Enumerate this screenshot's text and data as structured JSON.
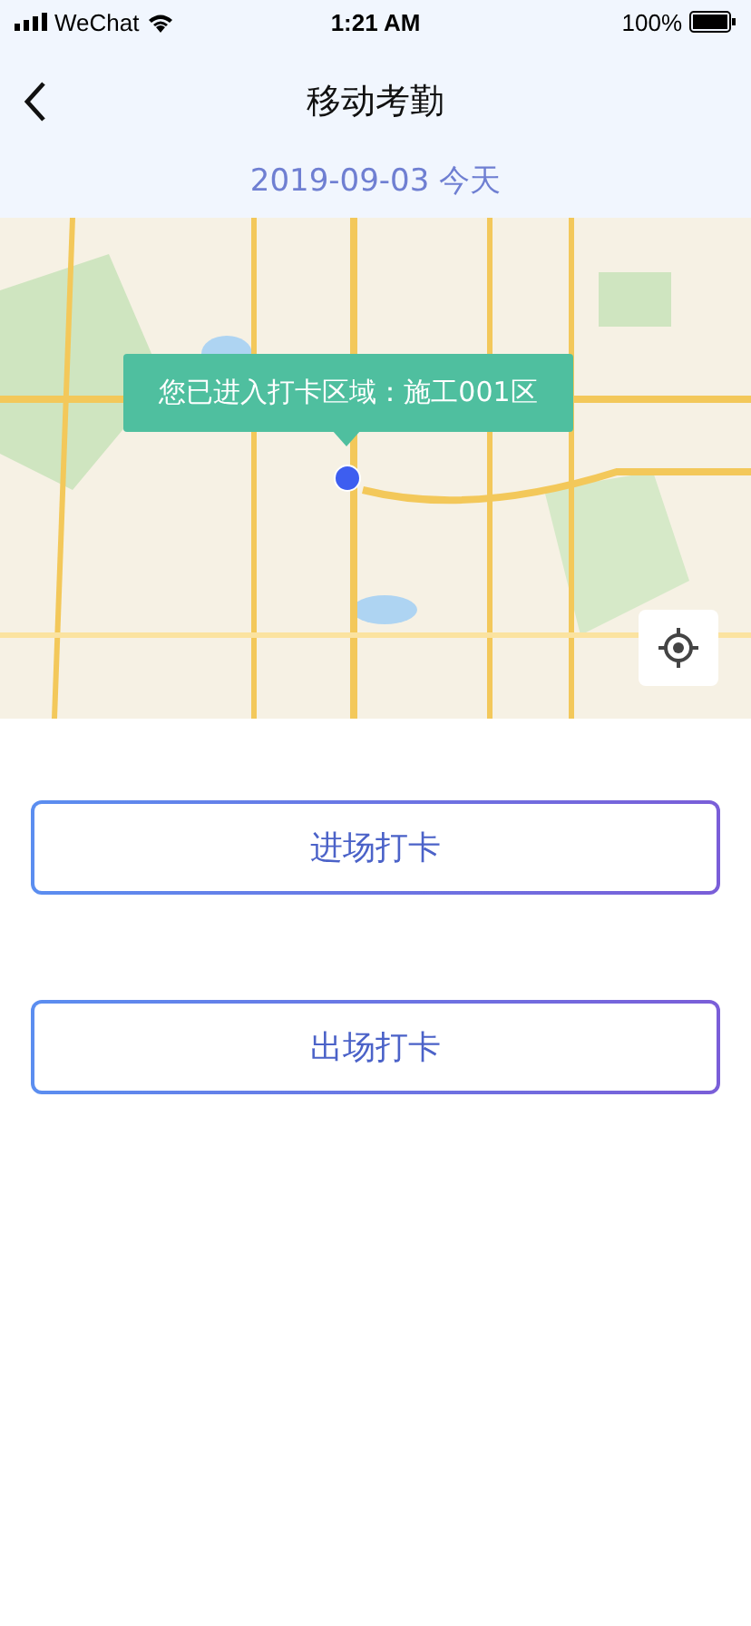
{
  "status_bar": {
    "carrier": "WeChat",
    "time": "1:21 AM",
    "battery": "100%"
  },
  "nav": {
    "title": "移动考勤"
  },
  "date": "2019-09-03 今天",
  "map": {
    "kind": "picture",
    "tooltip": "您已进入打卡区域：施工001区"
  },
  "buttons": [
    {
      "label": "进场打卡"
    },
    {
      "label": "出场打卡"
    }
  ]
}
